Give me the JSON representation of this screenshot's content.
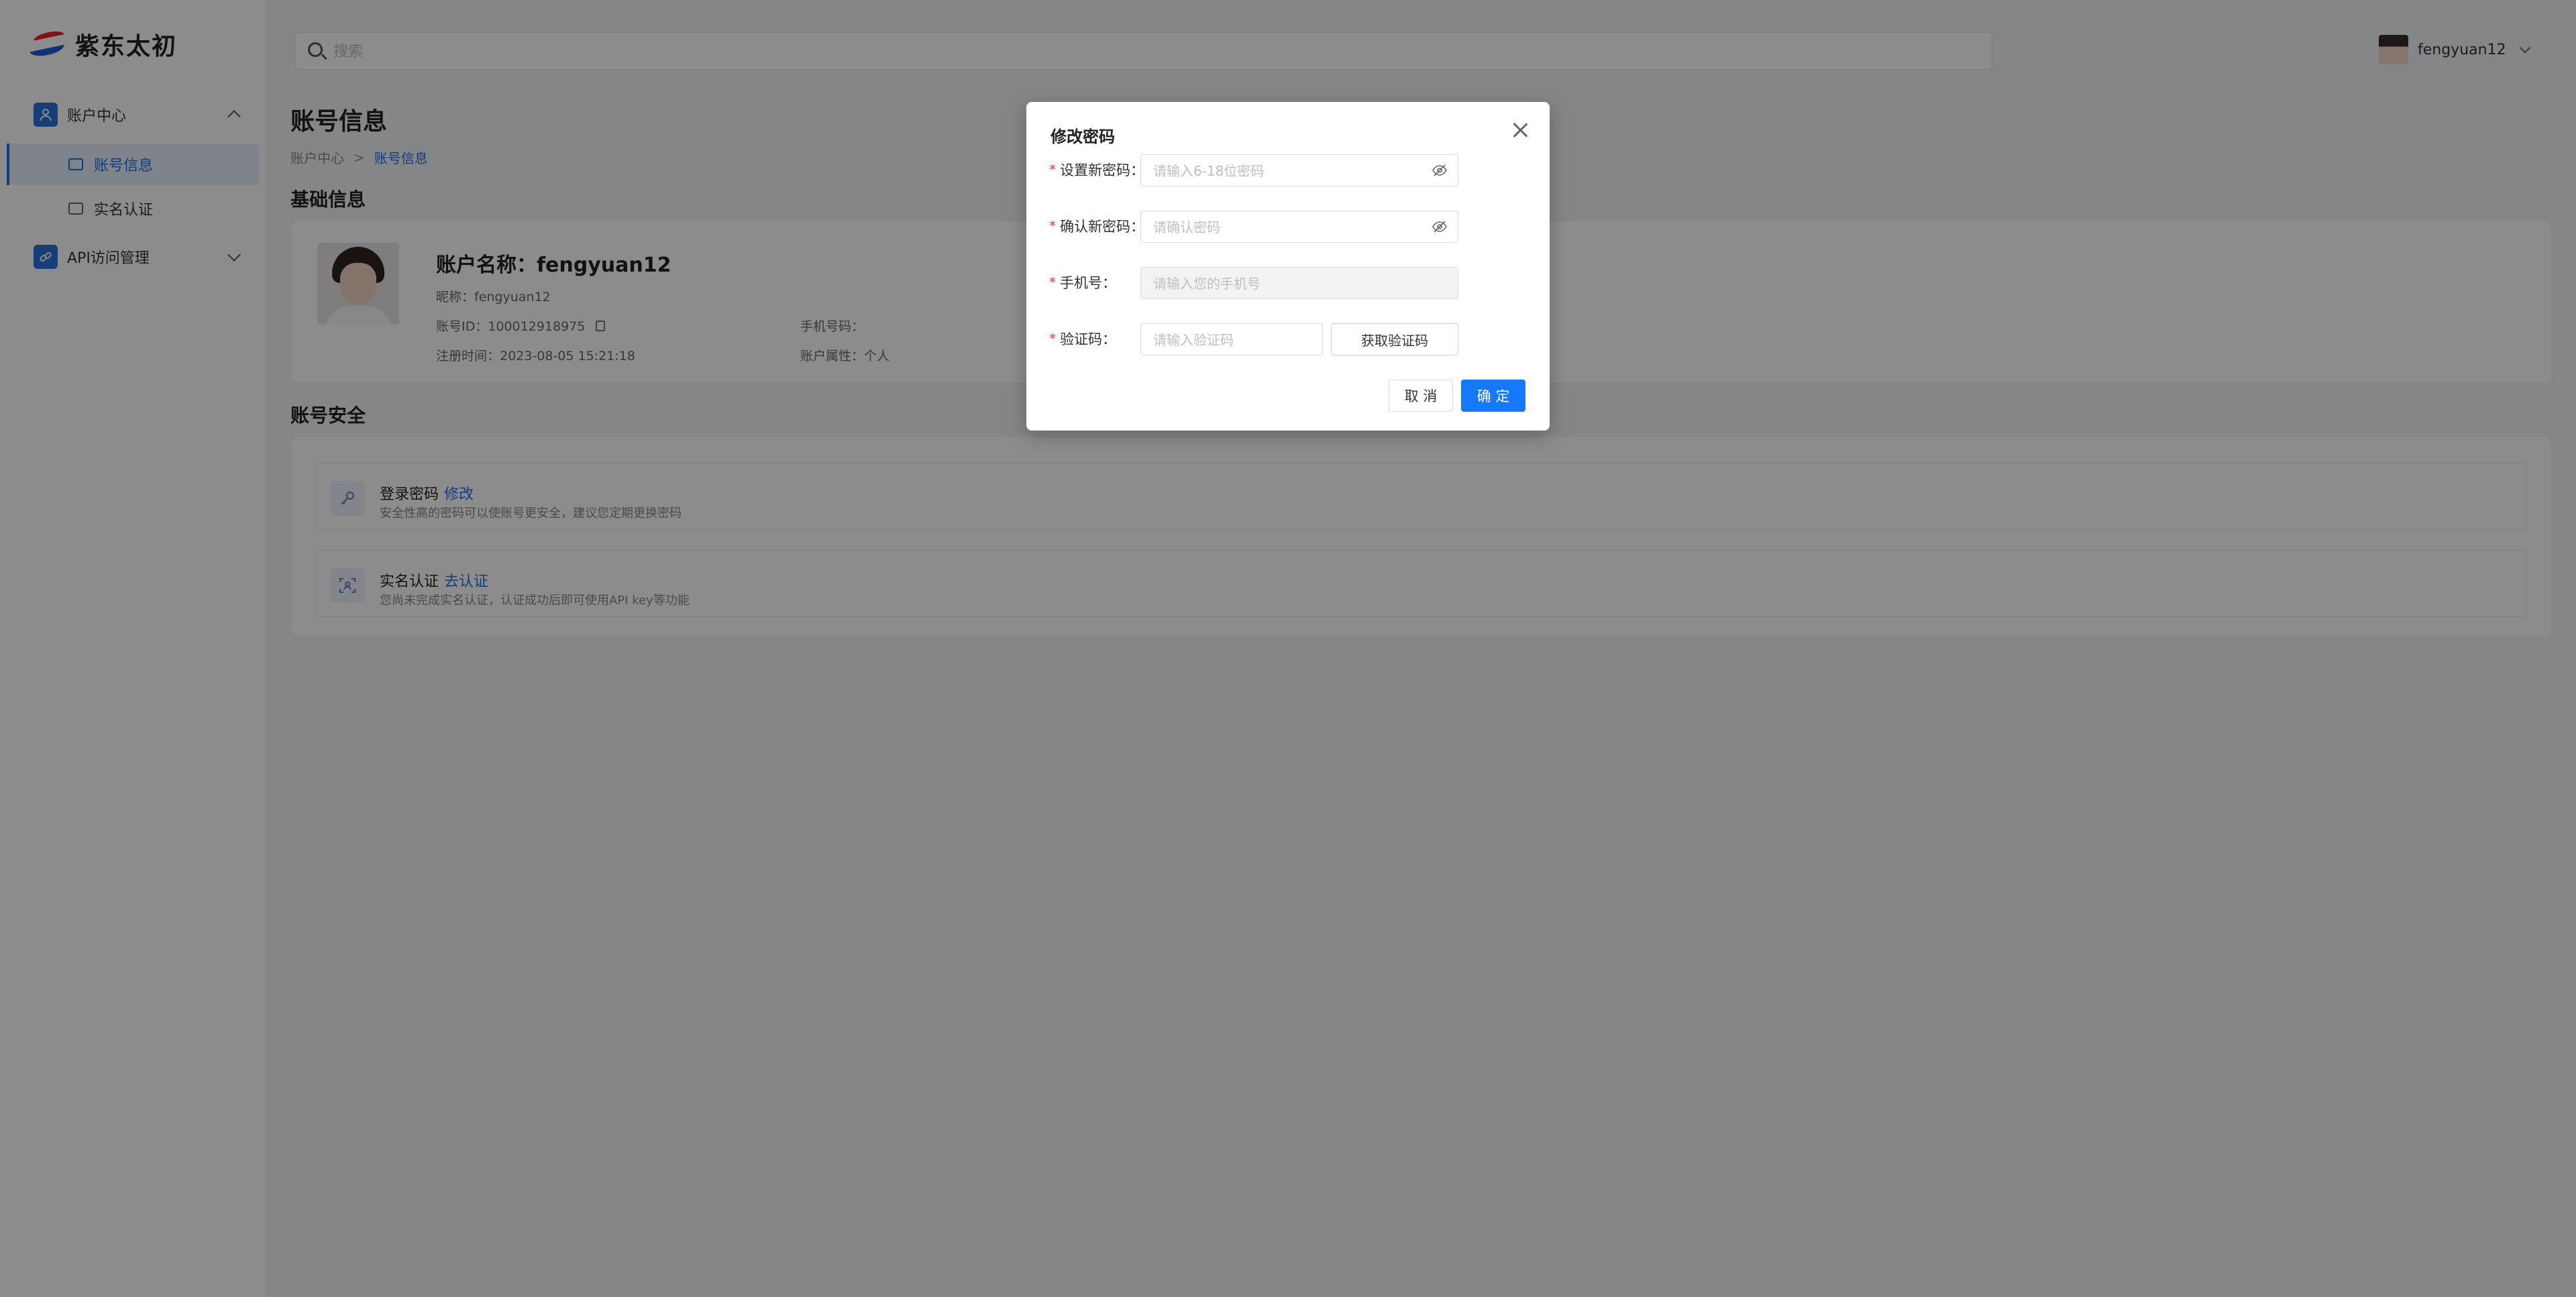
{
  "app": {
    "logo_text": "紫东太初"
  },
  "sidebar": {
    "groups": [
      {
        "label": "账户中心",
        "items": [
          {
            "label": "账号信息"
          },
          {
            "label": "实名认证"
          }
        ]
      },
      {
        "label": "API访问管理"
      }
    ]
  },
  "header": {
    "search_placeholder": "搜索",
    "username": "fengyuan12"
  },
  "main": {
    "page_title": "账号信息",
    "breadcrumb": {
      "parent": "账户中心",
      "separator": ">",
      "current": "账号信息"
    },
    "basic_info": {
      "section_title": "基础信息",
      "account_name": "账户名称：fengyuan12",
      "nickname": "昵称：fengyuan12",
      "account_id": "账号ID：100012918975",
      "register_time": "注册时间：2023-08-05 15:21:18",
      "phone_label": "手机号码：",
      "account_type": "账户属性：个人"
    },
    "security": {
      "section_title": "账号安全",
      "rows": [
        {
          "title": "登录密码",
          "action": "修改",
          "desc": "安全性高的密码可以使账号更安全，建议您定期更换密码"
        },
        {
          "title": "实名认证",
          "action": "去认证",
          "desc": "您尚未完成实名认证，认证成功后即可使用API key等功能"
        }
      ]
    }
  },
  "modal": {
    "title": "修改密码",
    "fields": {
      "new_password": {
        "label": "设置新密码：",
        "placeholder": "请输入6-18位密码"
      },
      "confirm_password": {
        "label": "确认新密码：",
        "placeholder": "请确认密码"
      },
      "phone": {
        "label": "手机号：",
        "placeholder": "请输入您的手机号"
      },
      "code": {
        "label": "验证码：",
        "placeholder": "请输入验证码"
      }
    },
    "required_mark": "*",
    "get_code_label": "获取验证码",
    "cancel_label": "取 消",
    "ok_label": "确 定"
  },
  "colors": {
    "primary": "#1677ff",
    "link": "#1f6fe5",
    "required": "#e4393c",
    "overlay": "rgba(0,0,0,0.45)"
  }
}
